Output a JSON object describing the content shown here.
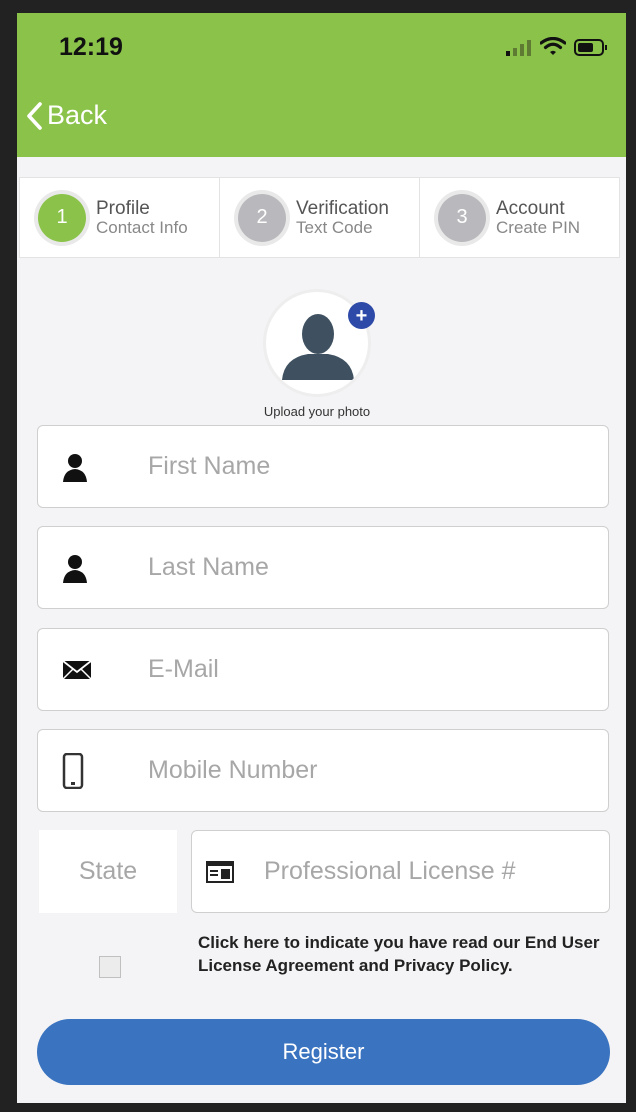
{
  "status_bar": {
    "time": "12:19"
  },
  "nav": {
    "back_label": "Back"
  },
  "steps": [
    {
      "number": "1",
      "title": "Profile",
      "subtitle": "Contact Info",
      "color": "#8bc34a"
    },
    {
      "number": "2",
      "title": "Verification",
      "subtitle": "Text Code",
      "color": "#b9b9bd"
    },
    {
      "number": "3",
      "title": "Account",
      "subtitle": "Create PIN",
      "color": "#b9b9bd"
    }
  ],
  "photo": {
    "label": "Upload your photo"
  },
  "form": {
    "first_name_placeholder": "First Name",
    "last_name_placeholder": "Last Name",
    "email_placeholder": "E-Mail",
    "mobile_placeholder": "Mobile Number",
    "state_label": "State",
    "license_placeholder": "Professional License #"
  },
  "terms": {
    "text": "Click here to indicate you have read our End User License Agreement and Privacy Policy."
  },
  "register": {
    "label": "Register",
    "color": "#3a73bf"
  },
  "colors": {
    "app_bar": "#8bc34a"
  }
}
